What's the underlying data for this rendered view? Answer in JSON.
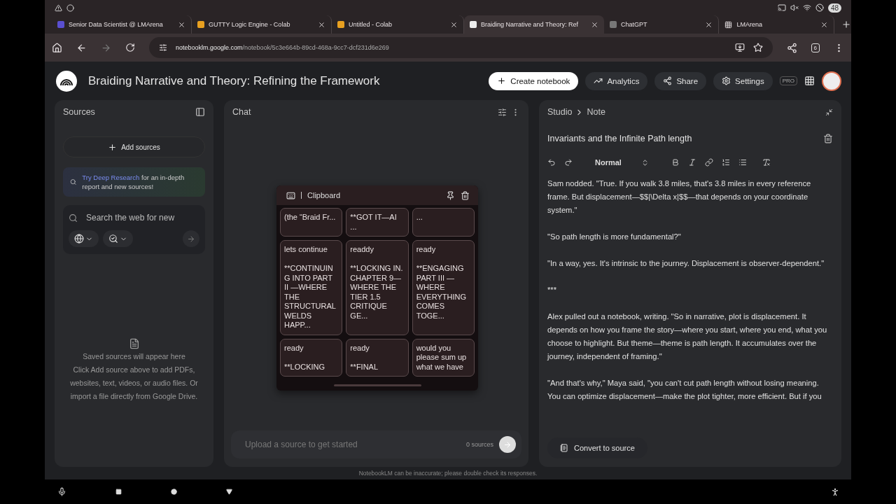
{
  "status_bar": {
    "battery": "48"
  },
  "tabs": [
    {
      "label": "Senior Data Scientist @ LMArena",
      "kind": "letter",
      "selected": false
    },
    {
      "label": "GUTTY Logic Engine - Colab",
      "kind": "colab",
      "selected": false
    },
    {
      "label": "Untitled - Colab",
      "kind": "colab",
      "selected": false
    },
    {
      "label": "Braiding Narrative and Theory: Ref",
      "kind": "notebook",
      "selected": true
    },
    {
      "label": "ChatGPT",
      "kind": "chat",
      "selected": false
    },
    {
      "label": "LMArena",
      "kind": "grid",
      "selected": false
    }
  ],
  "address_bar": {
    "host": "notebooklm.google.com",
    "path": "/notebook/5c3e664b-89cd-468a-9cc7-dcf231d6e269",
    "tab_count": "6"
  },
  "header": {
    "title": "Braiding Narrative and Theory: Refining the Framework",
    "buttons": [
      "Create notebook",
      "Analytics",
      "Share",
      "Settings"
    ],
    "badge": "PRO"
  },
  "sources": {
    "title": "Sources",
    "add_button": "Add sources",
    "promo_link": "Try Deep Research",
    "promo_text": " for an in-depth report and new sources!",
    "search_placeholder": "Search the web for new",
    "empty_title": "Saved sources will appear here",
    "empty_text": "Click Add source above to add PDFs, websites, text, videos, or audio files. Or import a file directly from Google Drive."
  },
  "chat": {
    "title": "Chat",
    "input_placeholder": "Upload a source to get started",
    "source_count": "0 sources"
  },
  "clipboard": {
    "title": "Clipboard",
    "items": [
      {
        "text": "(the “Braid Fr..."
      },
      {
        "text": "**GOT IT—AI ..."
      },
      {
        "text": "..."
      },
      {
        "text": "lets continue\n\n**CONTINUING INTO PART II —WHERE THE STRUCTURAL WELDS HAPP..."
      },
      {
        "text": "readdy\n\n**LOCKING IN. CHAPTER 9—WHERE THE TIER 1.5 CRITIQUE GE..."
      },
      {
        "text": "ready\n\n**ENGAGING PART III —WHERE EVERYTHING COMES TOGE..."
      },
      {
        "text": "ready\n\n**LOCKING"
      },
      {
        "text": "ready\n\n**FINAL"
      },
      {
        "text": "would you please sum up what we have"
      }
    ]
  },
  "studio": {
    "breadcrumb": [
      "Studio",
      "Note"
    ],
    "note_title": "Invariants and the Infinite Path length",
    "style_select": "Normal",
    "paragraphs": [
      "Sam nodded. \"True. If you walk 3.8 miles, that's 3.8 miles in every reference frame. But displacement—$$|\\Delta x|$$—that depends on your coordinate system.\"",
      "\"So path length is more fundamental?\"",
      "\"In a way, yes. It's intrinsic to the journey. Displacement is observer-dependent.\"",
      "***",
      "Alex pulled out a notebook, writing. \"So in narrative, plot is displacement. It depends on how you frame the story—where you start, where you end, what you choose to highlight. But theme—theme is path length. It accumulates over the journey, independent of framing.\"",
      "\"And that's why,\" Maya said, \"you can't cut path length without losing meaning. You can optimize displacement—make the plot tighter, more efficient. But if you"
    ],
    "convert_button": "Convert to source"
  },
  "footer": "NotebookLM can be inaccurate; please double check its responses."
}
